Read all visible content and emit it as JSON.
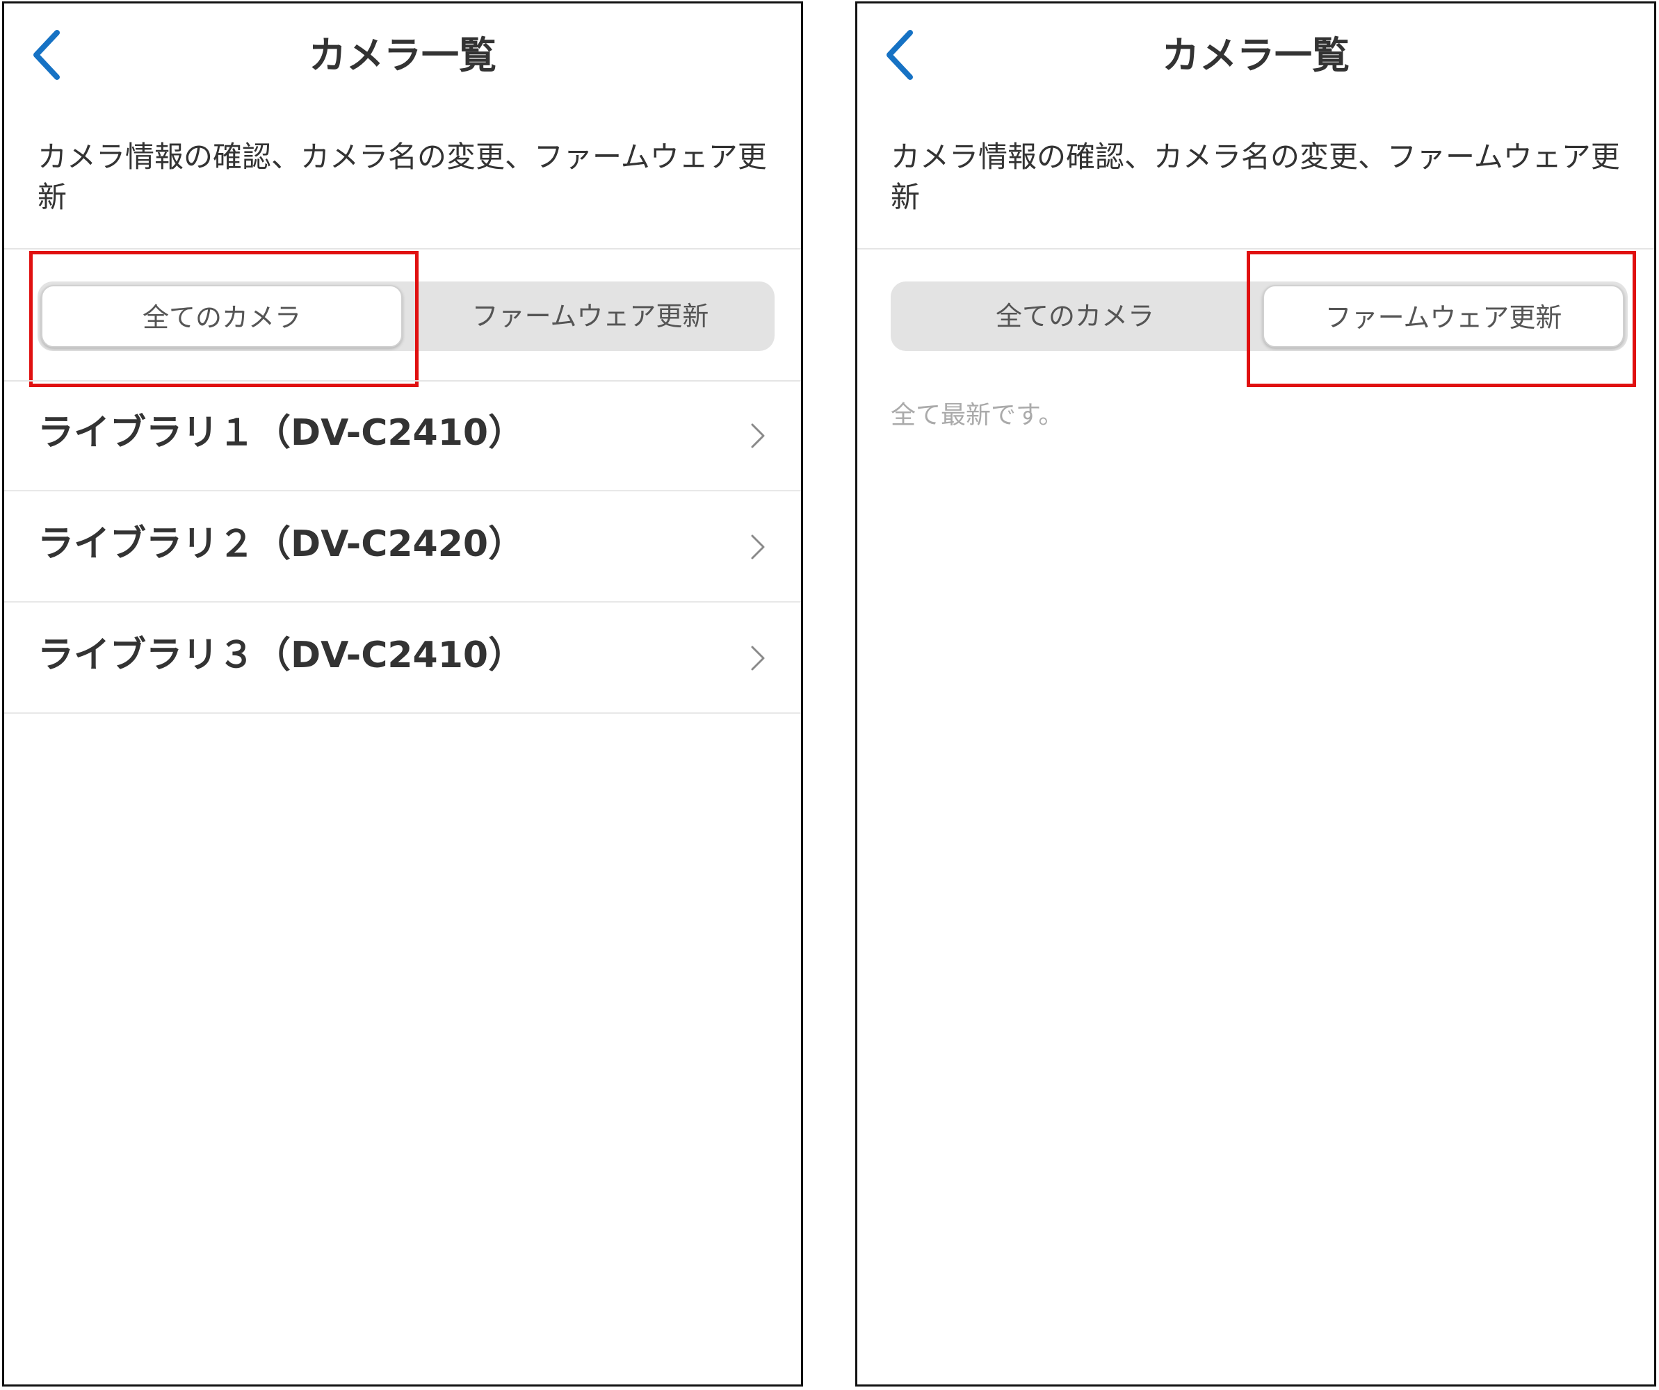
{
  "colors": {
    "accent": "#1672c4",
    "highlight": "#e01010",
    "segment_bg": "#e3e3e3"
  },
  "left_screen": {
    "header": {
      "title": "カメラ一覧",
      "back_icon": "chevron-left-icon"
    },
    "description": "カメラ情報の確認、カメラ名の変更、ファームウェア更新",
    "tabs": [
      {
        "label": "全てのカメラ",
        "selected": true
      },
      {
        "label": "ファームウェア更新",
        "selected": false
      }
    ],
    "cameras": [
      {
        "name": "ライブラリ１（DV-C2410）"
      },
      {
        "name": "ライブラリ２（DV-C2420）"
      },
      {
        "name": "ライブラリ３（DV-C2410）"
      }
    ]
  },
  "right_screen": {
    "header": {
      "title": "カメラ一覧",
      "back_icon": "chevron-left-icon"
    },
    "description": "カメラ情報の確認、カメラ名の変更、ファームウェア更新",
    "tabs": [
      {
        "label": "全てのカメラ",
        "selected": false
      },
      {
        "label": "ファームウェア更新",
        "selected": true
      }
    ],
    "status_message": "全て最新です。"
  }
}
